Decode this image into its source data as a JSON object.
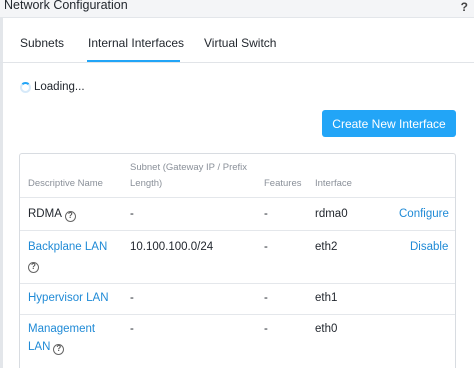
{
  "window": {
    "title": "Network Configuration",
    "help_label": "?"
  },
  "tabs": [
    {
      "label": "Subnets"
    },
    {
      "label": "Internal Interfaces"
    },
    {
      "label": "Virtual Switch"
    }
  ],
  "active_tab": "Internal Interfaces",
  "status": {
    "loading_text": "Loading..."
  },
  "actions": {
    "create_label": "Create New Interface"
  },
  "table": {
    "headers": {
      "descriptive_name": "Descriptive Name",
      "subnet_line1": "Subnet (Gateway IP / Prefix",
      "subnet_line2": "Length)",
      "features": "Features",
      "interface": "Interface"
    },
    "rows": [
      {
        "name": "RDMA",
        "subnet": "-",
        "features": "-",
        "interface": "rdma0",
        "action": "Configure"
      },
      {
        "name": "Backplane LAN",
        "subnet": "10.100.100.0/24",
        "features": "-",
        "interface": "eth2",
        "action": "Disable"
      },
      {
        "name": "Hypervisor LAN",
        "subnet": "-",
        "features": "-",
        "interface": "eth1"
      },
      {
        "name_line1": "Management",
        "name_line2": "LAN",
        "subnet": "-",
        "features": "-",
        "interface": "eth0"
      }
    ]
  },
  "colors": {
    "accent": "#22a5f7",
    "link": "#1f8ad6",
    "header_text": "#8a9099"
  },
  "icons": {
    "help": "question-circle-icon",
    "spinner": "loading-spinner-icon"
  }
}
